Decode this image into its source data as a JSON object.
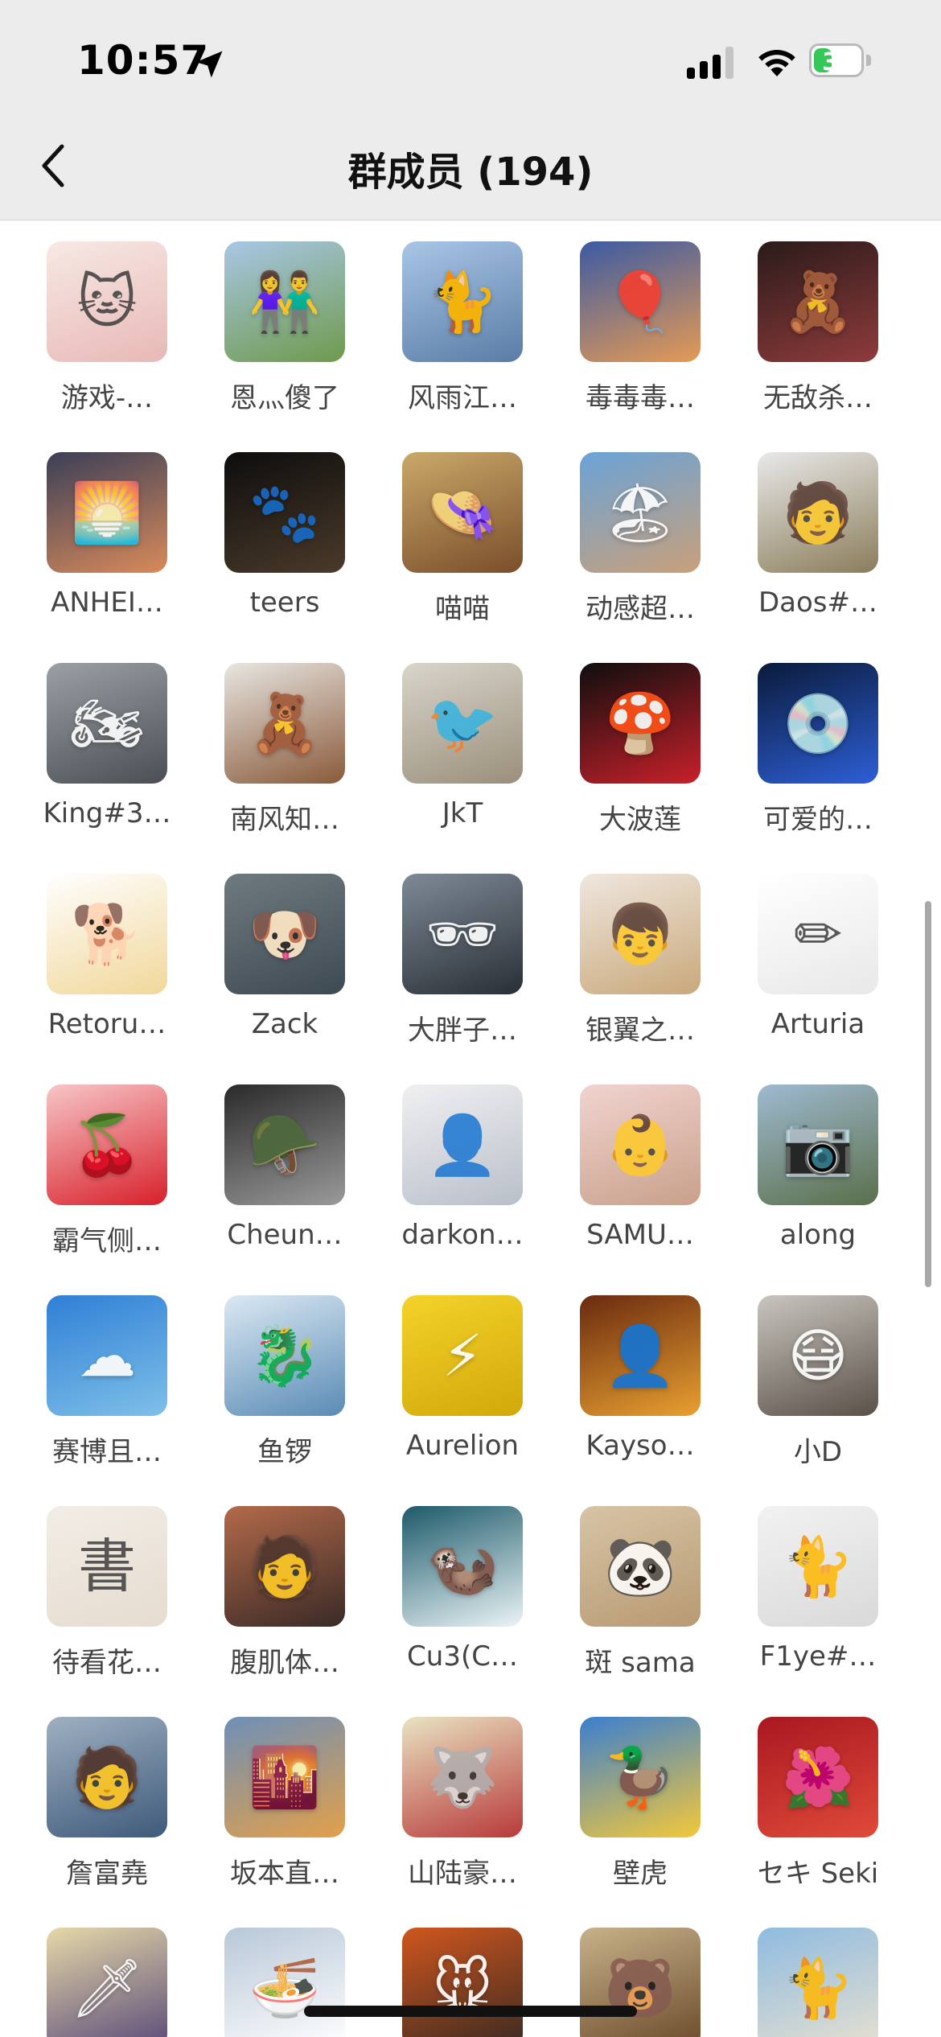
{
  "status_bar": {
    "time": "10:57",
    "battery": "35",
    "battery_fraction": 0.35,
    "location_icon": "location-arrow-icon",
    "signal_icon": "cellular-signal-icon",
    "wifi_icon": "wifi-icon"
  },
  "nav": {
    "back_icon": "chevron-left-icon",
    "title": "群成员 (194)"
  },
  "colors": {
    "header_bg": "#ececec",
    "battery_green": "#34c759",
    "name_text": "#444444"
  },
  "members": [
    {
      "name": "游戏-…",
      "icon": "cat-icon",
      "glyph": "🐱",
      "colors": [
        "#f7e9e4",
        "#e8b8b6"
      ],
      "light": true
    },
    {
      "name": "恩灬傻了",
      "icon": "couple-figures-icon",
      "glyph": "👫",
      "colors": [
        "#a8c7e6",
        "#6e9a4c"
      ]
    },
    {
      "name": "风雨江…",
      "icon": "cat-icon",
      "glyph": "🐈",
      "colors": [
        "#a9c6e6",
        "#5a7ca6"
      ]
    },
    {
      "name": "毒毒毒…",
      "icon": "hot-air-balloon-icon",
      "glyph": "🎈",
      "colors": [
        "#3b5aa3",
        "#e59a55"
      ]
    },
    {
      "name": "无敌杀…",
      "icon": "toy-bear-icon",
      "glyph": "🧸",
      "colors": [
        "#2b1a1a",
        "#8f3b3b"
      ]
    },
    {
      "name": "ANHEI…",
      "icon": "silhouette-sunset-icon",
      "glyph": "🌅",
      "colors": [
        "#3a3f58",
        "#d98a5a"
      ]
    },
    {
      "name": "teers",
      "icon": "cat-dark-icon",
      "glyph": "🐾",
      "colors": [
        "#0d0d0d",
        "#4a3a2a"
      ]
    },
    {
      "name": "喵喵",
      "icon": "anime-character-icon",
      "glyph": "👒",
      "colors": [
        "#caa96a",
        "#7a4e2a"
      ]
    },
    {
      "name": "动感超…",
      "icon": "person-beach-icon",
      "glyph": "🏖",
      "colors": [
        "#6aa3d8",
        "#c9a07a"
      ]
    },
    {
      "name": "Daos#…",
      "icon": "cartoon-man-icon",
      "glyph": "🧑",
      "colors": [
        "#e9e9e9",
        "#8a7d5a"
      ],
      "light": true
    },
    {
      "name": "King#3…",
      "icon": "motorcycle-icon",
      "glyph": "🏍",
      "colors": [
        "#9aa0a6",
        "#4b4f54"
      ]
    },
    {
      "name": "南风知…",
      "icon": "teddy-bear-icon",
      "glyph": "🧸",
      "colors": [
        "#e8e6e2",
        "#8a5a3a"
      ]
    },
    {
      "name": "JkT",
      "icon": "bird-icon",
      "glyph": "🐦",
      "colors": [
        "#d9d5cc",
        "#9a8f7a"
      ],
      "light": true
    },
    {
      "name": "大波莲",
      "icon": "mario-icon",
      "glyph": "🍄",
      "colors": [
        "#0e0e0e",
        "#c8202a"
      ]
    },
    {
      "name": "可爱的…",
      "icon": "album-cover-icon",
      "glyph": "💿",
      "colors": [
        "#0a1a3a",
        "#2d5fd6"
      ]
    },
    {
      "name": "Retoru…",
      "icon": "shiba-dog-icon",
      "glyph": "🐕",
      "colors": [
        "#ffffff",
        "#f1d79a"
      ],
      "light": true
    },
    {
      "name": "Zack",
      "icon": "dog-dolphin-icon",
      "glyph": "🐶",
      "colors": [
        "#6f7a80",
        "#3e4a52"
      ]
    },
    {
      "name": "大胖子…",
      "icon": "man-portrait-icon",
      "glyph": "🕶",
      "colors": [
        "#7e8a96",
        "#2a2f36"
      ]
    },
    {
      "name": "银翼之…",
      "icon": "anime-boy-icon",
      "glyph": "👦",
      "colors": [
        "#efe7df",
        "#c9a87a"
      ],
      "light": true
    },
    {
      "name": "Arturia",
      "icon": "sketch-figure-icon",
      "glyph": "✏",
      "colors": [
        "#ffffff",
        "#e8e8e8"
      ],
      "light": true
    },
    {
      "name": "霸气侧…",
      "icon": "cherry-icon",
      "glyph": "🍒",
      "colors": [
        "#f7c6c8",
        "#d8202a"
      ]
    },
    {
      "name": "Cheun…",
      "icon": "helmet-portrait-icon",
      "glyph": "🪖",
      "colors": [
        "#2a2a2a",
        "#9a9a9a"
      ]
    },
    {
      "name": "darkon…",
      "icon": "anime-boy-icon",
      "glyph": "👤",
      "colors": [
        "#f0f0f2",
        "#b9bfc9"
      ],
      "light": true
    },
    {
      "name": "SAMU…",
      "icon": "baby-icon",
      "glyph": "👶",
      "colors": [
        "#f1d4d0",
        "#c9a08a"
      ],
      "light": true
    },
    {
      "name": "along",
      "icon": "photographer-icon",
      "glyph": "📷",
      "colors": [
        "#9fbad1",
        "#5a6f4a"
      ]
    },
    {
      "name": "赛博且…",
      "icon": "sky-lake-icon",
      "glyph": "☁",
      "colors": [
        "#2f7fd6",
        "#7fc0e8"
      ]
    },
    {
      "name": "鱼锣",
      "icon": "baby-dragon-icon",
      "glyph": "🐉",
      "colors": [
        "#dbe9f3",
        "#5a8bb5"
      ],
      "light": true
    },
    {
      "name": "Aurelion",
      "icon": "pikachu-icon",
      "glyph": "⚡",
      "colors": [
        "#f5d22a",
        "#d1a90a"
      ]
    },
    {
      "name": "Kayso…",
      "icon": "blurred-portrait-icon",
      "glyph": "👤",
      "colors": [
        "#6a2a10",
        "#e8a030"
      ]
    },
    {
      "name": "小D",
      "icon": "masked-person-icon",
      "glyph": "😷",
      "colors": [
        "#c9c6bf",
        "#5a5048"
      ]
    },
    {
      "name": "待看花…",
      "icon": "calligraphy-icon",
      "glyph": "書",
      "colors": [
        "#f2ede6",
        "#e6dccf"
      ],
      "light": true
    },
    {
      "name": "腹肌体…",
      "icon": "man-selfie-icon",
      "glyph": "🧑",
      "colors": [
        "#b36a4a",
        "#3a2a26"
      ]
    },
    {
      "name": "Cu3(C…",
      "icon": "ferret-icon",
      "glyph": "🦦",
      "colors": [
        "#1d5a6a",
        "#eaf4f6"
      ]
    },
    {
      "name": "斑 sama",
      "icon": "panda-box-icon",
      "glyph": "🐼",
      "colors": [
        "#d7c4a6",
        "#b89a72"
      ],
      "light": true
    },
    {
      "name": "F1ye#…",
      "icon": "black-cat-icon",
      "glyph": "🐈",
      "colors": [
        "#f2f2f2",
        "#d9d9d9"
      ],
      "light": true
    },
    {
      "name": "詹富堯",
      "icon": "man-portrait-icon",
      "glyph": "🧑",
      "colors": [
        "#9fb0c2",
        "#3e5a7a"
      ]
    },
    {
      "name": "坂本直…",
      "icon": "sunset-sea-icon",
      "glyph": "🌇",
      "colors": [
        "#6e8fb8",
        "#e3a04a"
      ]
    },
    {
      "name": "山陆豪…",
      "icon": "wolf-character-icon",
      "glyph": "🐺",
      "colors": [
        "#e9e3c2",
        "#b83a3a"
      ],
      "light": true
    },
    {
      "name": "壁虎",
      "icon": "duck-cards-icon",
      "glyph": "🦆",
      "colors": [
        "#3a7fd0",
        "#f4c83a"
      ]
    },
    {
      "name": "セキ Seki",
      "icon": "flower-art-icon",
      "glyph": "🌺",
      "colors": [
        "#a81820",
        "#e04a3a"
      ]
    },
    {
      "name": "",
      "icon": "anime-character-icon",
      "glyph": "🗡",
      "colors": [
        "#e6d9a8",
        "#5a4a7a"
      ]
    },
    {
      "name": "",
      "icon": "snow-food-icon",
      "glyph": "🍜",
      "colors": [
        "#b8c8d8",
        "#ffffff"
      ],
      "light": true
    },
    {
      "name": "",
      "icon": "cartoon-rat-icon",
      "glyph": "🐭",
      "colors": [
        "#d0561e",
        "#3a2a22"
      ]
    },
    {
      "name": "",
      "icon": "cartoon-bear-icon",
      "glyph": "🐻",
      "colors": [
        "#c8b28a",
        "#6a4a2a"
      ],
      "light": true
    },
    {
      "name": "",
      "icon": "coast-cat-icon",
      "glyph": "🐈",
      "colors": [
        "#8fbbe0",
        "#e6e0d0"
      ],
      "light": true
    }
  ]
}
